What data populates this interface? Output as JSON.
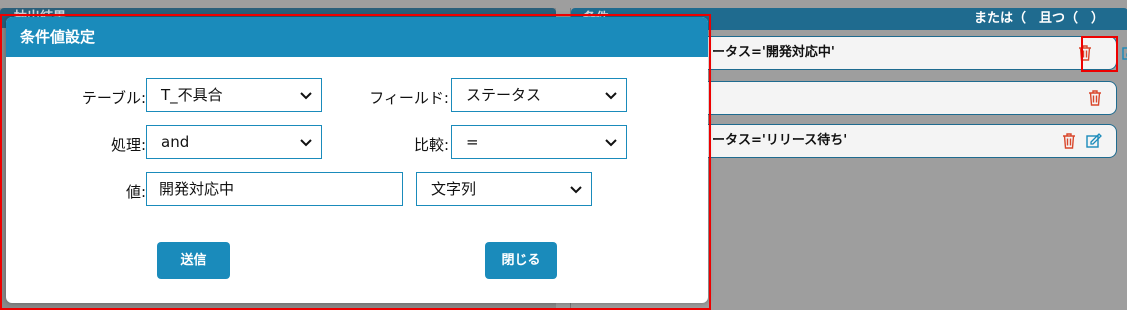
{
  "background": {
    "left_panel_title": "抽出結果",
    "right_panel_title": "条件",
    "right_panel_controls": "または（　且つ（　）",
    "conditions": [
      {
        "text": "ータス='開発対応中'"
      },
      {
        "text": ""
      },
      {
        "text": "ータス='リリース待ち'"
      }
    ]
  },
  "dialog": {
    "title": "条件値設定",
    "table_label": "テーブル:",
    "table_value": "T_不具合",
    "field_label": "フィールド:",
    "field_value": "ステータス",
    "process_label": "処理:",
    "process_value": "and",
    "compare_label": "比較:",
    "compare_value": "=",
    "value_label": "値:",
    "value_input": "開発対応中",
    "type_value": "文字列",
    "submit_label": "送信",
    "close_label": "閉じる"
  },
  "colors": {
    "accent": "#1a8bbb",
    "highlight": "#e00000",
    "trash": "#d9472b"
  }
}
